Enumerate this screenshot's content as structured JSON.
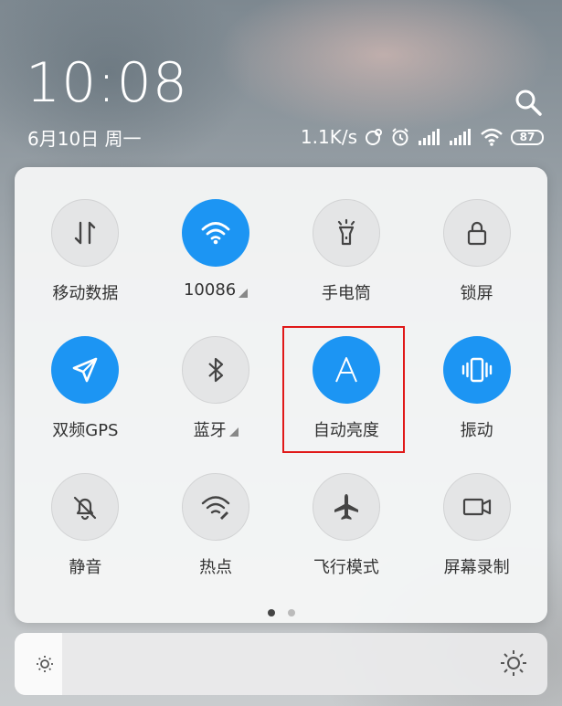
{
  "status": {
    "time": "10:08",
    "date": "6月10日 周一",
    "net_speed": "1.1K/s",
    "battery": "87"
  },
  "tiles": [
    {
      "label": "移动数据",
      "icon": "mobile-data-icon",
      "active": false
    },
    {
      "label": "10086",
      "icon": "wifi-icon",
      "active": true,
      "expand": true
    },
    {
      "label": "手电筒",
      "icon": "flashlight-icon",
      "active": false
    },
    {
      "label": "锁屏",
      "icon": "lock-icon",
      "active": false
    },
    {
      "label": "双频GPS",
      "icon": "location-arrow-icon",
      "active": true
    },
    {
      "label": "蓝牙",
      "icon": "bluetooth-icon",
      "active": false,
      "expand": true
    },
    {
      "label": "自动亮度",
      "icon": "auto-brightness-icon",
      "active": true,
      "highlighted": true
    },
    {
      "label": "振动",
      "icon": "vibrate-icon",
      "active": true
    },
    {
      "label": "静音",
      "icon": "mute-bell-icon",
      "active": false
    },
    {
      "label": "热点",
      "icon": "hotspot-icon",
      "active": false
    },
    {
      "label": "飞行模式",
      "icon": "airplane-icon",
      "active": false
    },
    {
      "label": "屏幕录制",
      "icon": "screen-record-icon",
      "active": false
    }
  ],
  "pager": {
    "count": 2,
    "current": 0
  },
  "brightness": {
    "level": 0.09
  },
  "colors": {
    "accent": "#1c95f3",
    "highlight": "#e01818",
    "icon_off": "#444444"
  }
}
